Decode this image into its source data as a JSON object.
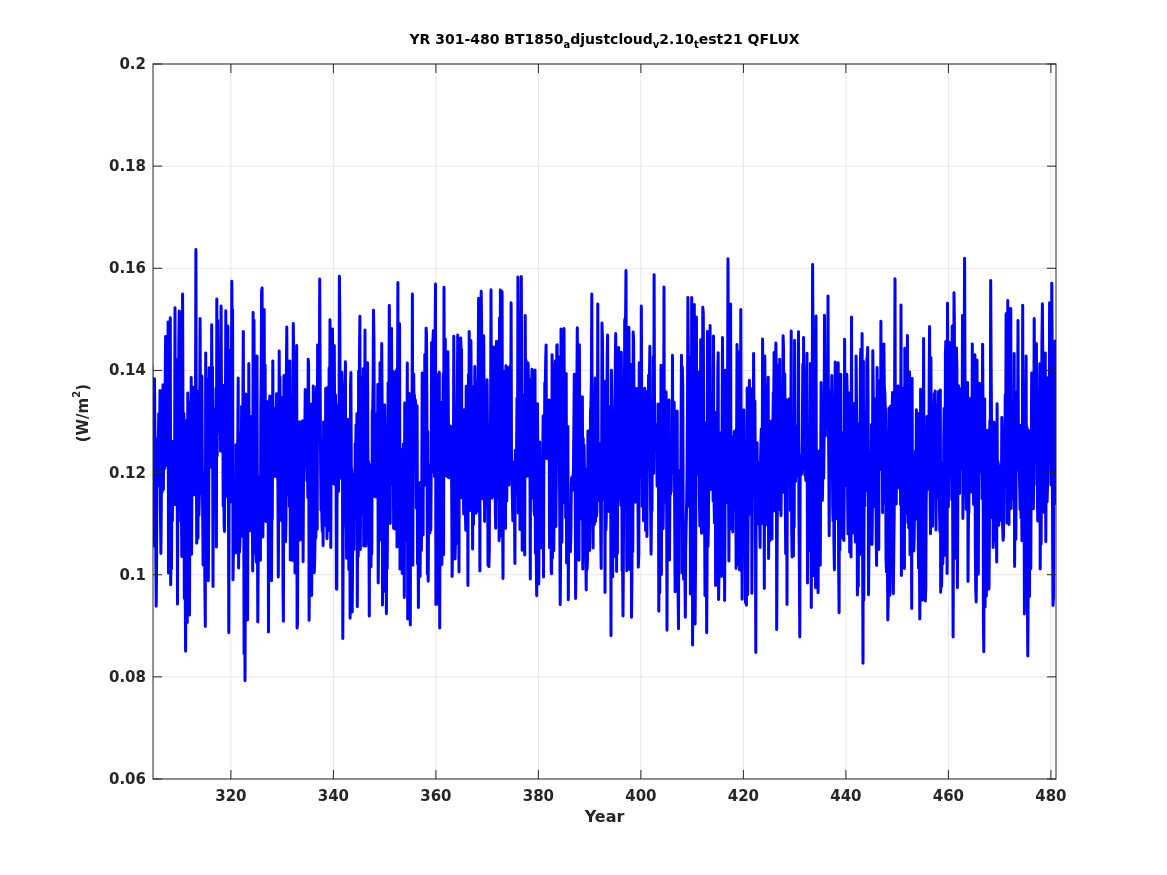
{
  "figure": {
    "title": "YR 301-480 BT1850$_{a}$djustcloud$_{v}$2.10$_{t}$est21 QFLUX",
    "xlabel": "Year",
    "ylabel": "(W/m$^{2}$)",
    "xticks": [
      "320",
      "340",
      "360",
      "380",
      "400",
      "420",
      "440",
      "460",
      "480"
    ],
    "yticks": [
      "0.2",
      "0.18",
      "0.16",
      "0.14",
      "0.12",
      "0.1",
      "0.08",
      "0.06"
    ]
  }
}
